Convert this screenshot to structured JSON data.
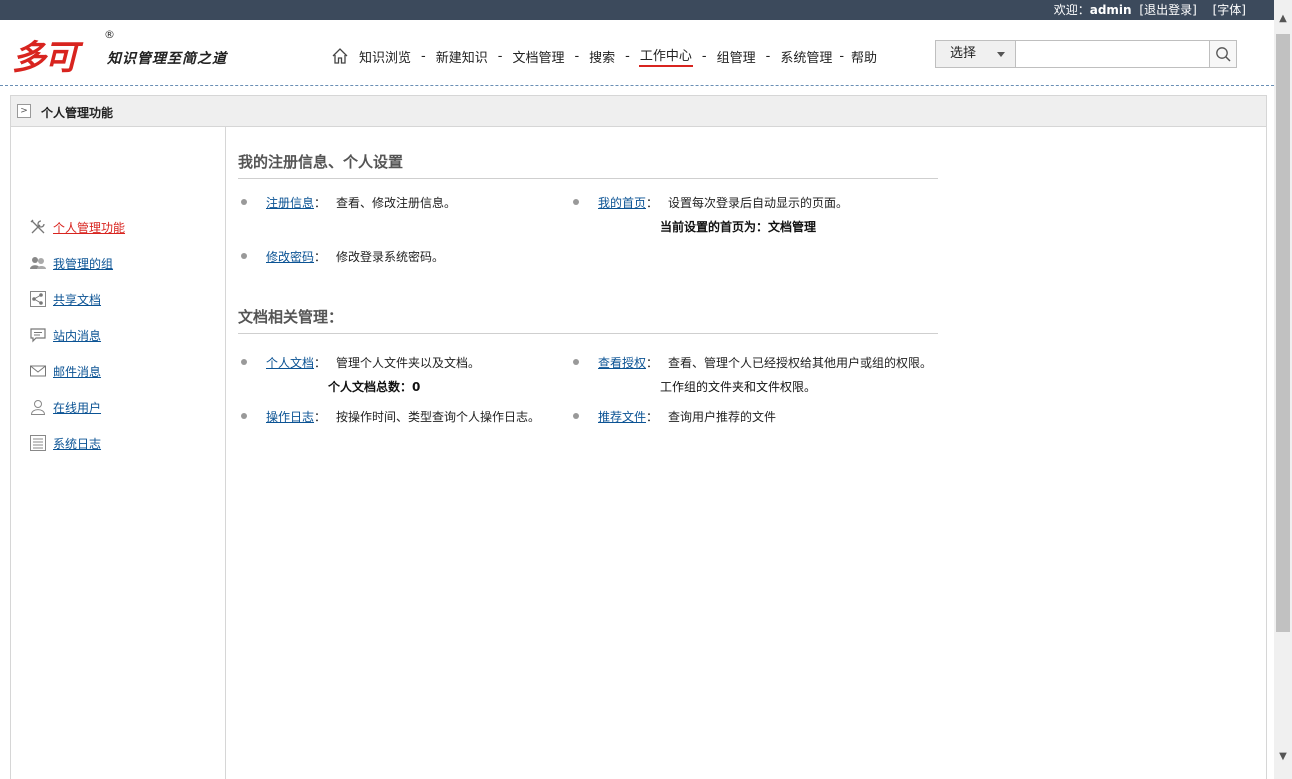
{
  "topbar": {
    "welcome": "欢迎：",
    "user": "admin",
    "logout": "[退出登录]",
    "font": "[字体]"
  },
  "logo": {
    "brand": "多可",
    "reg": "®",
    "slogan": "知识管理至简之道"
  },
  "nav": {
    "items": [
      "知识浏览",
      "新建知识",
      "文档管理",
      "搜索",
      "工作中心",
      "组管理",
      "系统管理",
      "帮助"
    ],
    "separator": "-",
    "active": "工作中心"
  },
  "search": {
    "select_label": "选择",
    "placeholder": ""
  },
  "panel": {
    "title": "个人管理功能"
  },
  "sidebar": {
    "items": [
      {
        "label": "个人管理功能",
        "icon": "tools-icon"
      },
      {
        "label": "我管理的组",
        "icon": "group-icon"
      },
      {
        "label": "共享文档",
        "icon": "share-icon"
      },
      {
        "label": "站内消息",
        "icon": "message-icon"
      },
      {
        "label": "邮件消息",
        "icon": "mail-icon"
      },
      {
        "label": "在线用户",
        "icon": "user-icon"
      },
      {
        "label": "系统日志",
        "icon": "log-icon"
      }
    ]
  },
  "main": {
    "section1": {
      "title": "我的注册信息、个人设置",
      "entries": [
        {
          "label": "注册信息",
          "colon": "：",
          "desc": "查看、修改注册信息。"
        },
        {
          "label": "我的首页",
          "colon": "：",
          "desc": "设置每次登录后自动显示的页面。",
          "sub": "当前设置的首页为：文档管理"
        },
        {
          "label": "修改密码",
          "colon": "：",
          "desc": "修改登录系统密码。"
        }
      ]
    },
    "section2": {
      "title": "文档相关管理：",
      "entries": [
        {
          "label": "个人文档",
          "colon": "：",
          "desc": "管理个人文件夹以及文档。",
          "sub": "个人文档总数：0"
        },
        {
          "label": "查看授权",
          "colon": "：",
          "desc": "查看、管理个人已经授权给其他用户或组的权限。",
          "sub": "工作组的文件夹和文件权限。"
        },
        {
          "label": "操作日志",
          "colon": "：",
          "desc": "按操作时间、类型查询个人操作日志。"
        },
        {
          "label": "推荐文件",
          "colon": "：",
          "desc": "查询用户推荐的文件"
        }
      ]
    }
  },
  "colors": {
    "topbar": "#3c4a5c",
    "accent_red": "#d8241f",
    "link": "#0b5394"
  }
}
